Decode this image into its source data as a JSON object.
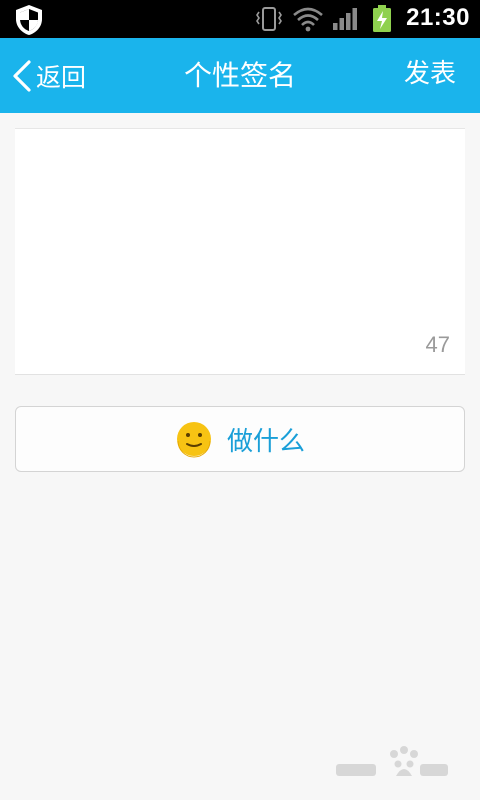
{
  "status_bar": {
    "time": "21:30",
    "icons": [
      "shield-icon",
      "vibrate-icon",
      "wifi-icon",
      "signal-icon",
      "battery-charging-icon"
    ]
  },
  "header": {
    "back_label": "返回",
    "title": "个性签名",
    "publish_label": "发表"
  },
  "editor": {
    "value": "",
    "placeholder": "",
    "char_remaining": "47"
  },
  "action_button": {
    "label": "做什么",
    "icon": "smiley-icon"
  },
  "colors": {
    "header_bg": "#1ab4ec",
    "action_text": "#1a9fd8",
    "page_bg": "#f7f7f7"
  }
}
